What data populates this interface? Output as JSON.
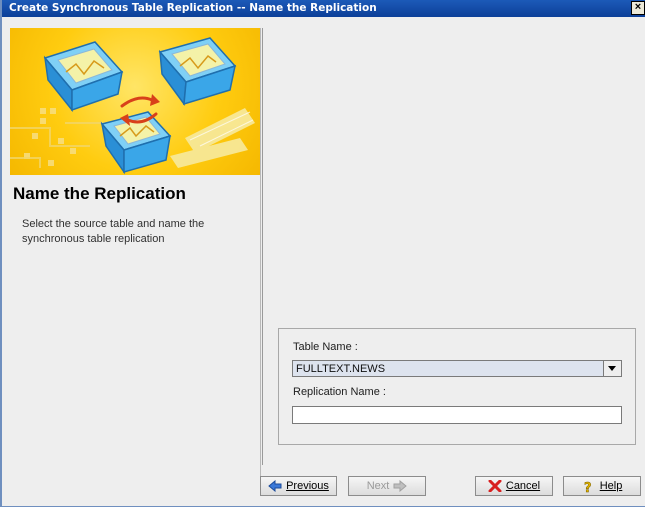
{
  "window": {
    "title": "Create Synchronous Table Replication -- Name the Replication",
    "close_label": "×"
  },
  "left_panel": {
    "heading": "Name the Replication",
    "description": "Select the source table and name the synchronous table replication"
  },
  "form": {
    "table_name_label": "Table Name :",
    "table_name_value": "FULLTEXT.NEWS",
    "replication_name_label": "Replication Name :",
    "replication_name_value": ""
  },
  "buttons": {
    "previous": "Previous",
    "next": "Next",
    "cancel": "Cancel",
    "help": "Help"
  },
  "colors": {
    "titlebar": "#0c3f98",
    "banner": "#ffcc10",
    "cube": "#2fa6e6"
  }
}
